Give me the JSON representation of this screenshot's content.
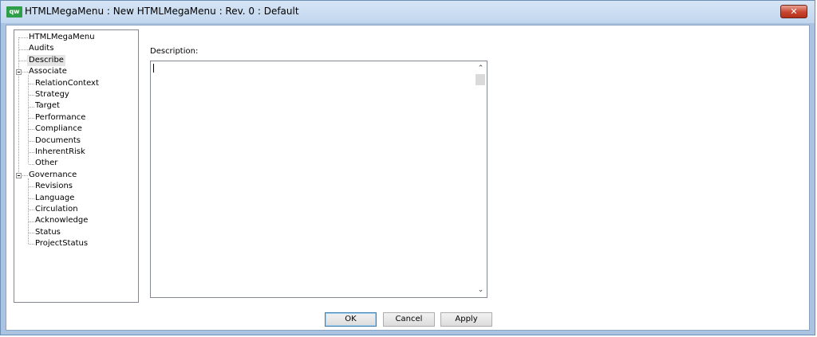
{
  "window": {
    "title": "HTMLMegaMenu : New HTMLMegaMenu : Rev. 0  : Default",
    "app_icon_text": "qw",
    "close_glyph": "✕"
  },
  "tree": {
    "items": [
      {
        "label": "HTMLMegaMenu",
        "level": 0
      },
      {
        "label": "Audits",
        "level": 0
      },
      {
        "label": "Describe",
        "level": 0,
        "selected": true
      },
      {
        "label": "Associate",
        "level": 0,
        "expander": true
      },
      {
        "label": "RelationContext",
        "level": 1
      },
      {
        "label": "Strategy",
        "level": 1
      },
      {
        "label": "Target",
        "level": 1
      },
      {
        "label": "Performance",
        "level": 1
      },
      {
        "label": "Compliance",
        "level": 1
      },
      {
        "label": "Documents",
        "level": 1
      },
      {
        "label": "InherentRisk",
        "level": 1
      },
      {
        "label": "Other",
        "level": 1
      },
      {
        "label": "Governance",
        "level": 0,
        "expander": true
      },
      {
        "label": "Revisions",
        "level": 1
      },
      {
        "label": "Language",
        "level": 1
      },
      {
        "label": "Circulation",
        "level": 1
      },
      {
        "label": "Acknowledge",
        "level": 1
      },
      {
        "label": "Status",
        "level": 1
      },
      {
        "label": "ProjectStatus",
        "level": 1
      }
    ]
  },
  "description": {
    "label": "Description:",
    "value": "",
    "scroll_up_glyph": "⌃",
    "scroll_down_glyph": "⌄"
  },
  "buttons": {
    "ok": "OK",
    "cancel": "Cancel",
    "apply": "Apply"
  },
  "colors": {
    "frame": "#aac3e0",
    "close": "#c8452f",
    "app_icon": "#2f9e49",
    "selection": "#e5e5e5"
  },
  "icons": {
    "app": "qw-app-icon",
    "close": "close-icon",
    "expander": "tree-collapse-icon"
  }
}
